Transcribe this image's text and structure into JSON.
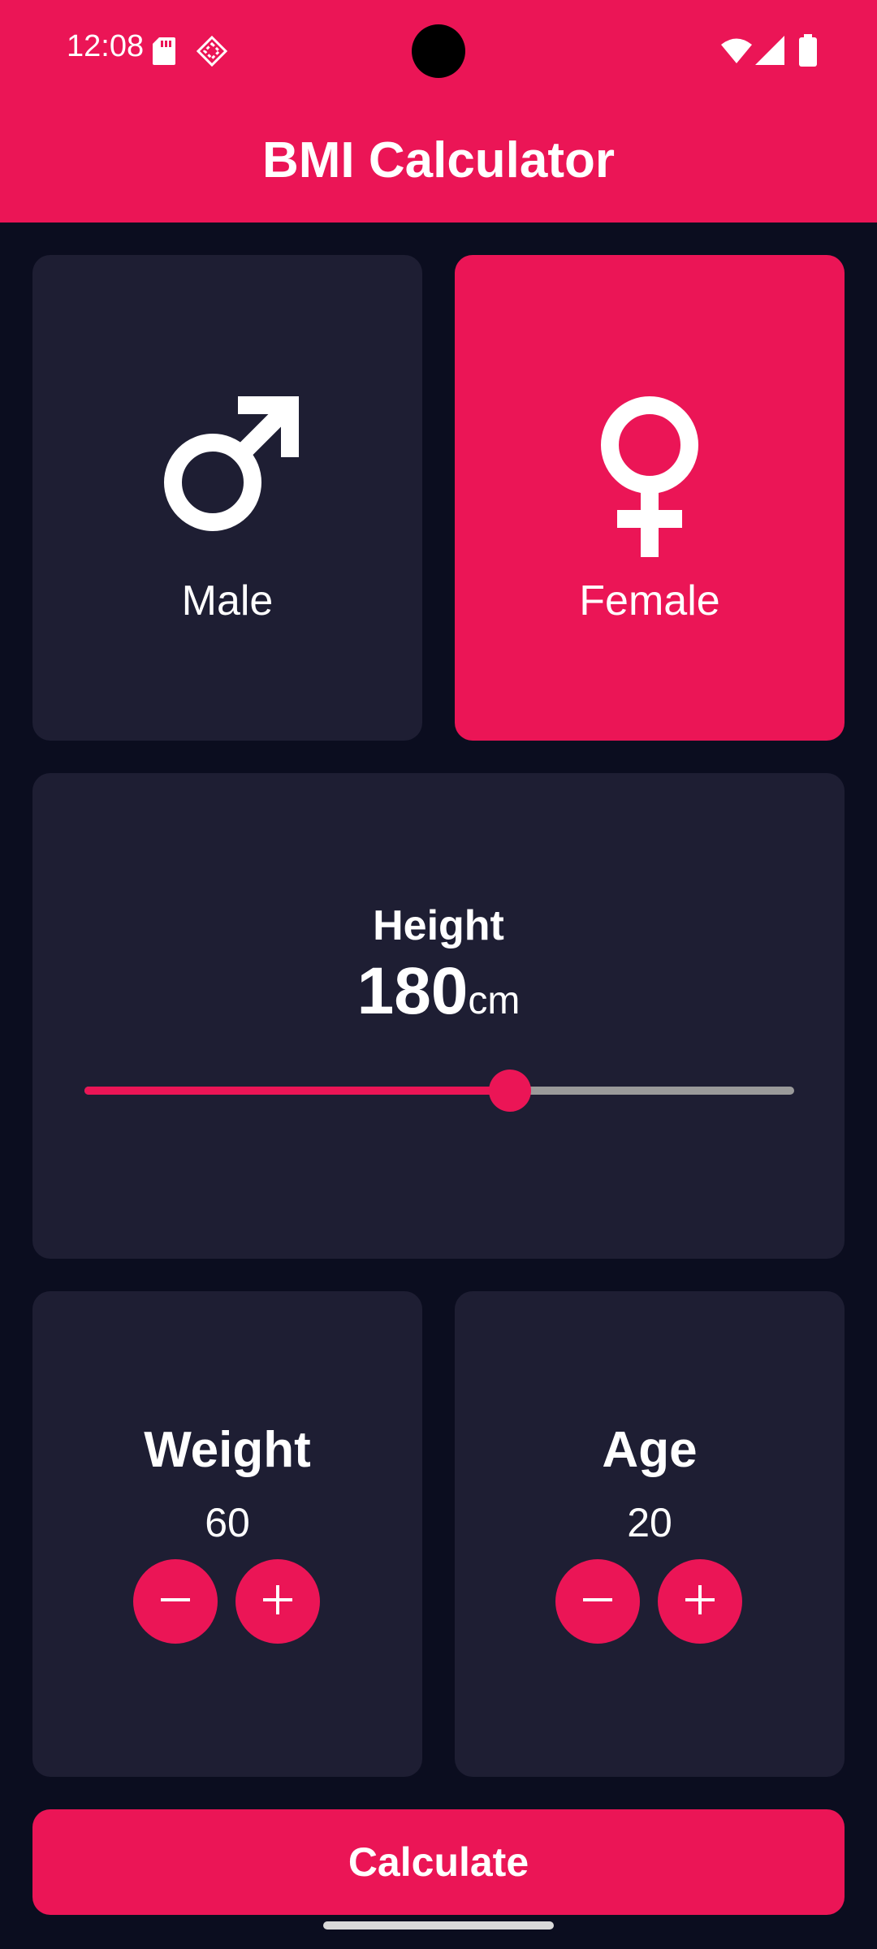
{
  "status_bar": {
    "time": "12:08"
  },
  "app": {
    "title": "BMI Calculator",
    "accent": "#eb1556",
    "card_color": "#1e1e33",
    "bg_color": "#0b0d1f"
  },
  "gender": {
    "selected": "female",
    "male_label": "Male",
    "female_label": "Female"
  },
  "height": {
    "label": "Height",
    "value": "180",
    "unit": "cm",
    "slider_fraction": 0.6
  },
  "weight": {
    "label": "Weight",
    "value": "60"
  },
  "age": {
    "label": "Age",
    "value": "20"
  },
  "actions": {
    "calculate_label": "Calculate"
  },
  "icons": [
    "sd-card-icon",
    "developer-icon",
    "wifi-icon",
    "signal-icon",
    "battery-icon",
    "male-icon",
    "female-icon",
    "minus-icon",
    "plus-icon"
  ]
}
